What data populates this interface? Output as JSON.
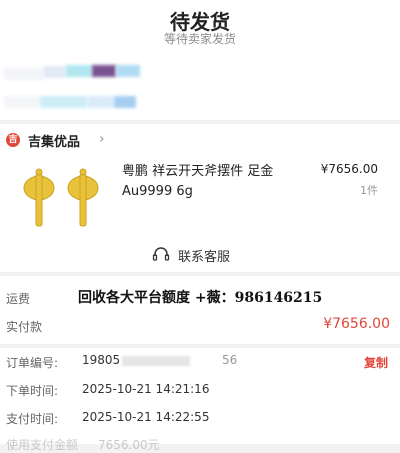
{
  "header": {
    "title": "待发货",
    "subtitle": "等待卖家发货"
  },
  "shop": {
    "badge": "吉",
    "name": "吉集优品",
    "chevron": "›"
  },
  "product": {
    "image_icon": "golden-axe-ornament-image",
    "title": "粤鹏 祥云开天斧摆件 足金 Au9999 6g",
    "price": "¥7656.00",
    "quantity": "1件"
  },
  "customer_service": {
    "icon": "headset-icon",
    "label": "联系客服"
  },
  "amounts": {
    "freight_label": "运费",
    "paid_label": "实付款",
    "paid_value": "¥7656.00",
    "overlay_text": "回收各大平台额度 +薇：986146215"
  },
  "order_info": {
    "order_no_label": "订单编号:",
    "order_no_start": "19805",
    "order_no_end": "56",
    "copy_label": "复制",
    "order_time_label": "下单时间:",
    "order_time": "2025-10-21 14:21:16",
    "pay_time_label": "支付时间:",
    "pay_time": "2025-10-21 14:22:55",
    "partial_label": "使用支付金额",
    "partial_value": "7656.00元"
  },
  "colors": {
    "accent_red": "#e2473a",
    "gold": "#e8c23a",
    "muted": "#8c8c8c"
  }
}
